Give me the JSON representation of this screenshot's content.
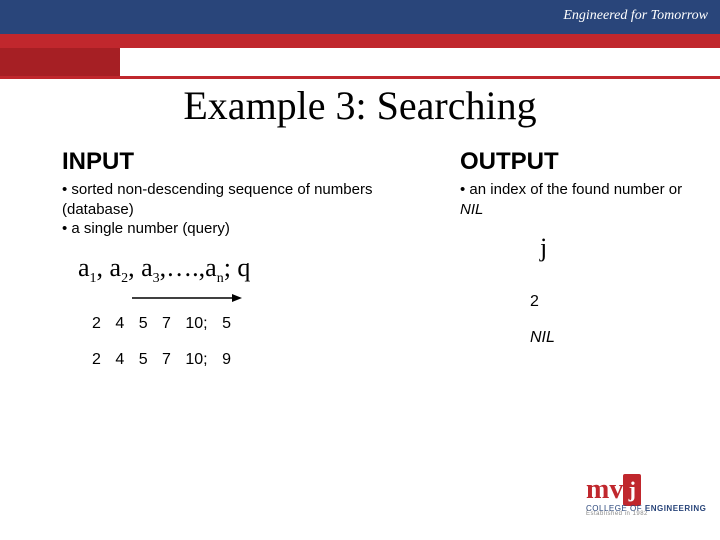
{
  "topbar_tagline": "Engineered for Tomorrow",
  "title": "Example 3: Searching",
  "input": {
    "heading": "INPUT",
    "bullet1": "• sorted non-descending sequence of numbers (database)",
    "bullet2": "• a single number (query)",
    "sequence_label_a": "a",
    "sequence_dots": ",….,",
    "sequence_q": ";  q",
    "row1": "2   4   5   7   10;   5",
    "row2": "2   4   5   7   10;   9"
  },
  "output": {
    "heading": "OUTPUT",
    "bullet1_prefix": "• an index of the found number or ",
    "bullet1_nil": "NIL",
    "j": "j",
    "val1": "2",
    "val2": "NIL"
  },
  "logo": {
    "m": "m",
    "v": "v",
    "j": "j",
    "sub1_prefix": "COLLEGE OF ",
    "sub1_bold": "ENGINEERING",
    "sub2": "Established in 1982"
  }
}
